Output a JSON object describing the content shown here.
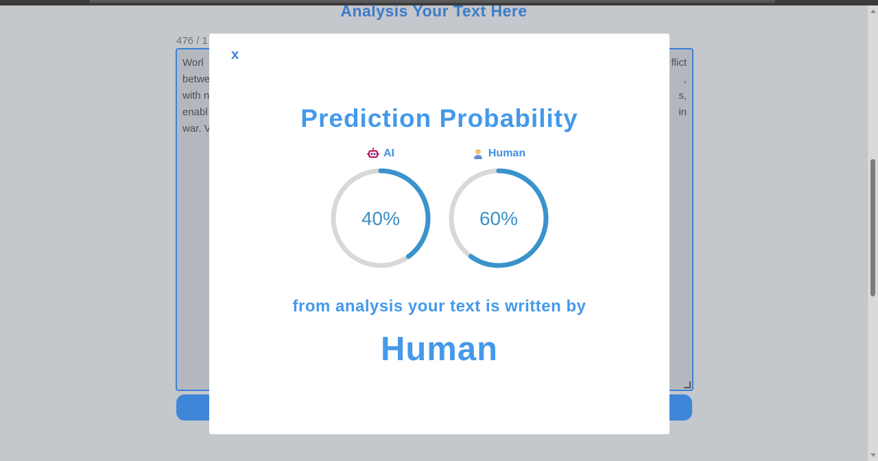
{
  "background": {
    "heading": "Analysis Your Text Here",
    "char_counter": "476 / 1",
    "textarea_lines": [
      [
        "Worl",
        "flict"
      ],
      [
        "betwe",
        ","
      ],
      [
        "with n",
        "s,"
      ],
      [
        "enabl",
        "in"
      ],
      [
        "war. V",
        ""
      ]
    ]
  },
  "modal": {
    "close_label": "x",
    "title": "Prediction Probability",
    "gauges": [
      {
        "label": "AI",
        "icon": "robot-icon",
        "value": 40,
        "value_text": "40%"
      },
      {
        "label": "Human",
        "icon": "person-icon",
        "value": 60,
        "value_text": "60%"
      }
    ],
    "subtext": "from analysis your text is written by",
    "result": "Human"
  },
  "colors": {
    "accent": "#4499ea",
    "gauge_fill": "#3a93cc",
    "gauge_track": "#d8d8d8",
    "overlay": "#c4c7cc"
  }
}
